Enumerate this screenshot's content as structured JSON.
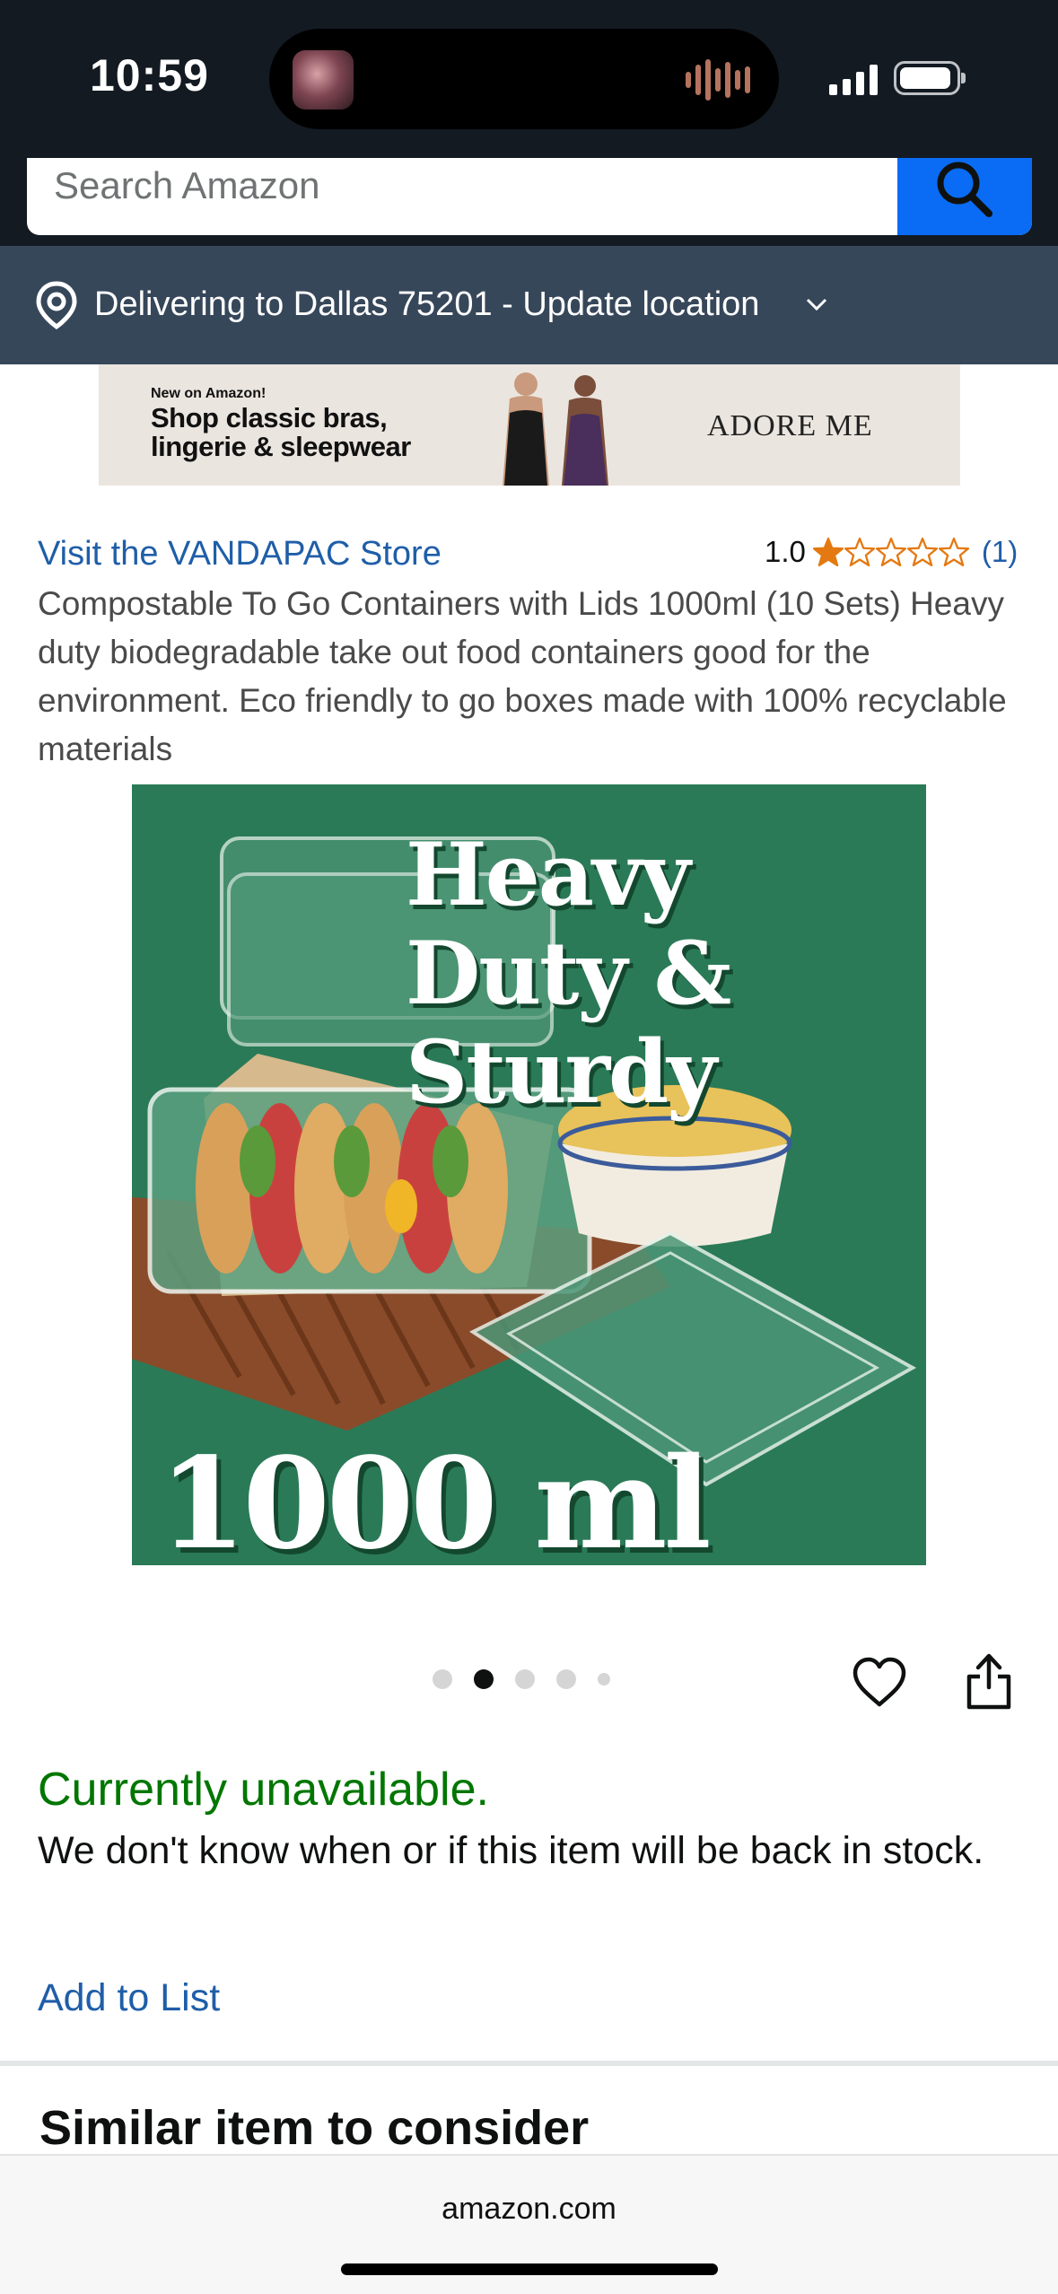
{
  "status_bar": {
    "time": "10:59"
  },
  "search": {
    "placeholder": "Search Amazon"
  },
  "location": {
    "text": "Delivering to Dallas 75201 - Update location"
  },
  "ad": {
    "small_text": "New on Amazon!",
    "headline": "Shop classic bras, lingerie & sleepwear",
    "brand": "ADORE ME"
  },
  "product": {
    "store_link": "Visit the VANDAPAC Store",
    "rating_value": "1.0",
    "rating_stars": 1,
    "rating_count": "(1)",
    "title": "Compostable To Go Containers with Lids 1000ml (10 Sets) Heavy duty biodegradable take out food containers good for the environment. Eco friendly to go boxes made with 100% recyclable materials",
    "image": {
      "heading": "Heavy Duty & Sturdy",
      "volume": "1000 ml"
    },
    "carousel": {
      "total": 5,
      "active_index": 1
    }
  },
  "availability": {
    "status": "Currently unavailable.",
    "detail": "We don't know when or if this item will be back in stock.",
    "add_to_list": "Add to List"
  },
  "similar": {
    "heading": "Similar item to consider"
  },
  "browser": {
    "url": "amazon.com"
  },
  "colors": {
    "header_bg": "#131a22",
    "location_bg": "#37475a",
    "search_button": "#0a6cf5",
    "link": "#1f5ea8",
    "unavailable": "#007600",
    "star": "#e47911",
    "image_bg": "#2a7a57"
  }
}
